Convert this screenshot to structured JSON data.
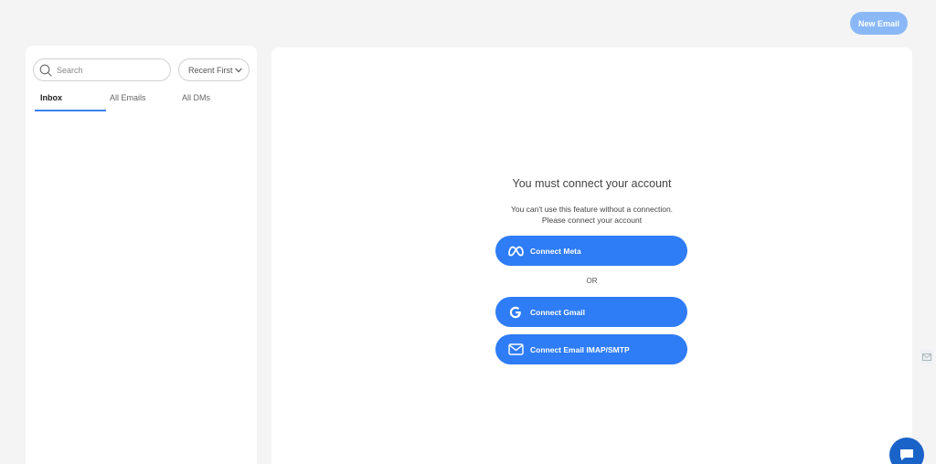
{
  "header": {
    "new_email_label": "New Email"
  },
  "sidebar": {
    "search": {
      "placeholder": "Search",
      "value": ""
    },
    "sort": {
      "selected": "Recent First"
    },
    "tabs": [
      {
        "label": "Inbox",
        "active": true
      },
      {
        "label": "All Emails",
        "active": false
      },
      {
        "label": "All DMs",
        "active": false
      }
    ]
  },
  "main": {
    "title": "You must connect your account",
    "subtitle_line1": "You can't use this feature without a connection.",
    "subtitle_line2": "Please connect your account",
    "connect_meta_label": "Connect Meta",
    "or_label": "OR",
    "connect_gmail_label": "Connect Gmail",
    "connect_imap_label": "Connect Email IMAP/SMTP"
  },
  "icons": {
    "search": "search-icon",
    "chevron": "chevron-down-icon",
    "meta": "meta-icon",
    "google": "google-icon",
    "mail": "mail-icon",
    "chat": "chat-icon",
    "side": "gmail-side-icon"
  },
  "colors": {
    "background": "#f4f4f5",
    "accent": "#2e7cf6",
    "new_email_button": "#8ab8f6",
    "tab_underline": "#3b82f6",
    "chat_bubble": "#1a63c9"
  }
}
